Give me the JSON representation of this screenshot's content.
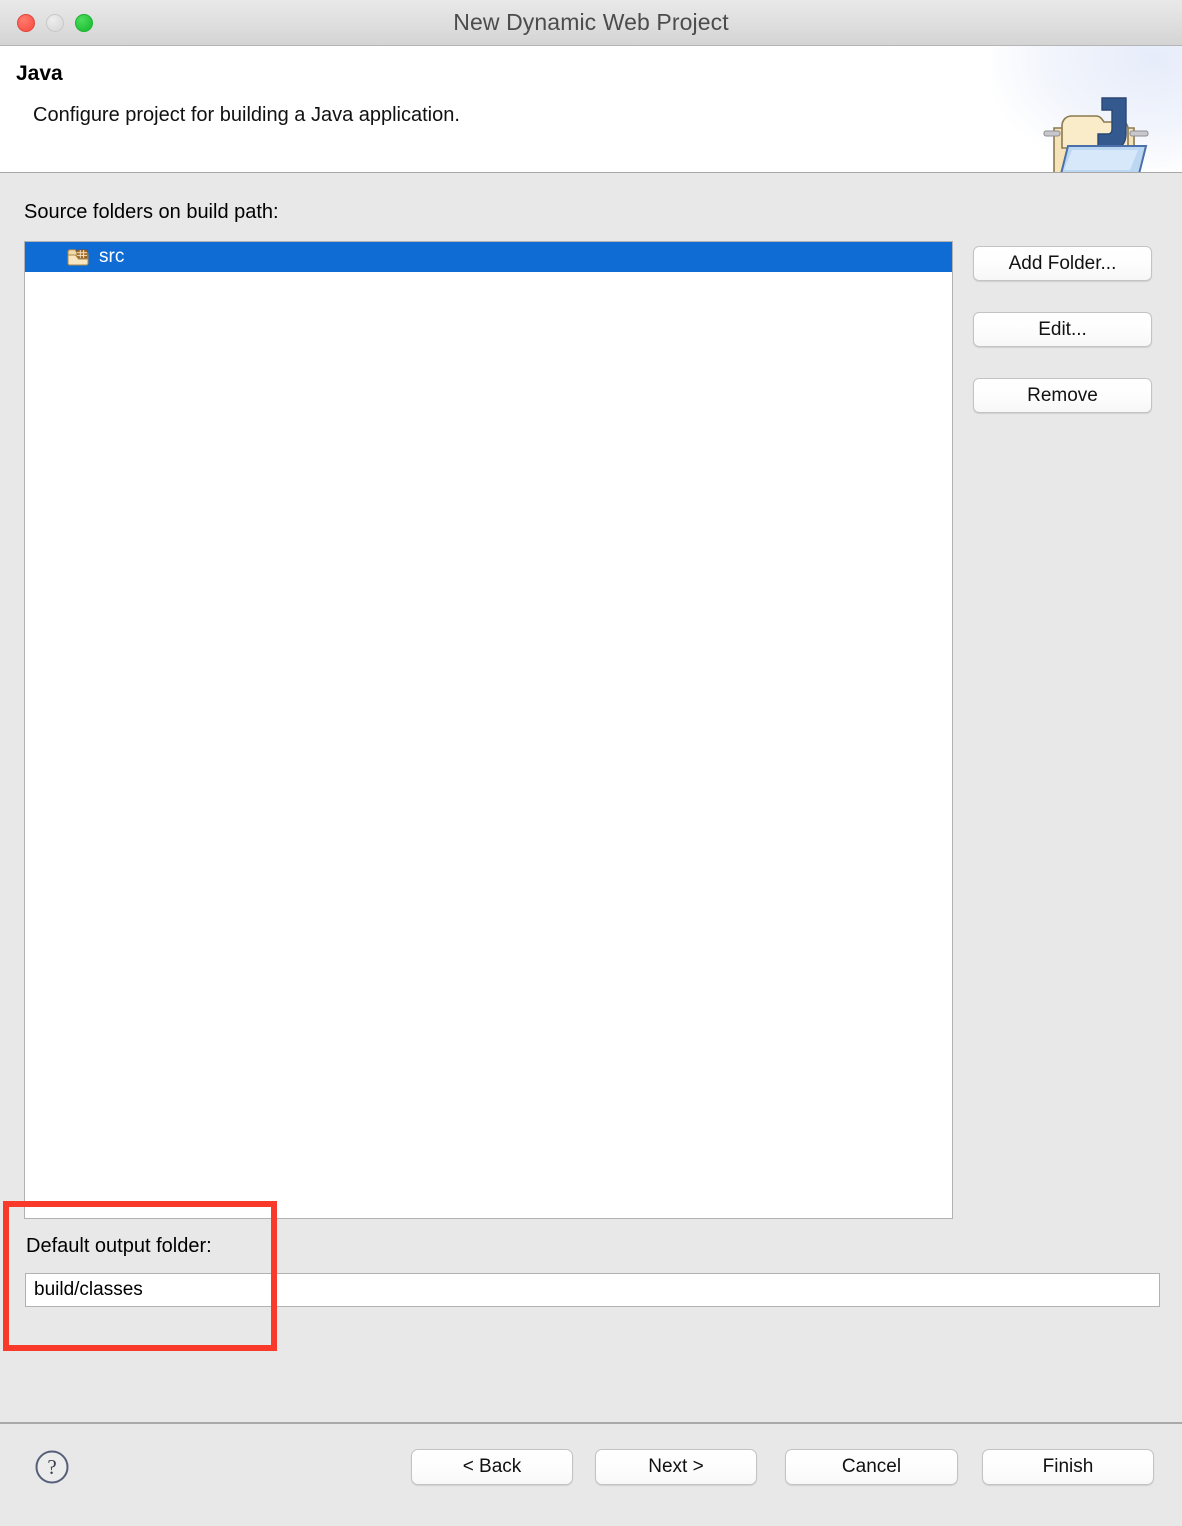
{
  "window": {
    "title": "New Dynamic Web Project",
    "traffic_lights": {
      "close": "close-window-button",
      "minimize": "minimize-window-button",
      "maximize": "maximize-window-button"
    }
  },
  "header": {
    "title": "Java",
    "description": "Configure project for building a Java application.",
    "icon": "java-folder-wizard-icon"
  },
  "main": {
    "list_label": "Source folders on build path:",
    "source_folders": [
      {
        "name": "src",
        "selected": true,
        "icon": "source-folder-icon"
      }
    ],
    "side_buttons": [
      {
        "id": "add-folder",
        "label": "Add Folder..."
      },
      {
        "id": "edit",
        "label": "Edit..."
      },
      {
        "id": "remove",
        "label": "Remove"
      }
    ],
    "output": {
      "label": "Default output folder:",
      "value": "build/classes",
      "placeholder": ""
    }
  },
  "annotation": {
    "name": "red-highlight-box",
    "color": "#f93a2b"
  },
  "footer": {
    "help_icon": "help-question-icon",
    "buttons": [
      {
        "id": "back",
        "label": "< Back"
      },
      {
        "id": "next",
        "label": "Next >"
      },
      {
        "id": "cancel",
        "label": "Cancel"
      },
      {
        "id": "finish",
        "label": "Finish"
      }
    ]
  },
  "colors": {
    "selection_blue": "#0f6cd4",
    "annotation_red": "#f93a2b",
    "window_background": "#e8e8e8"
  }
}
